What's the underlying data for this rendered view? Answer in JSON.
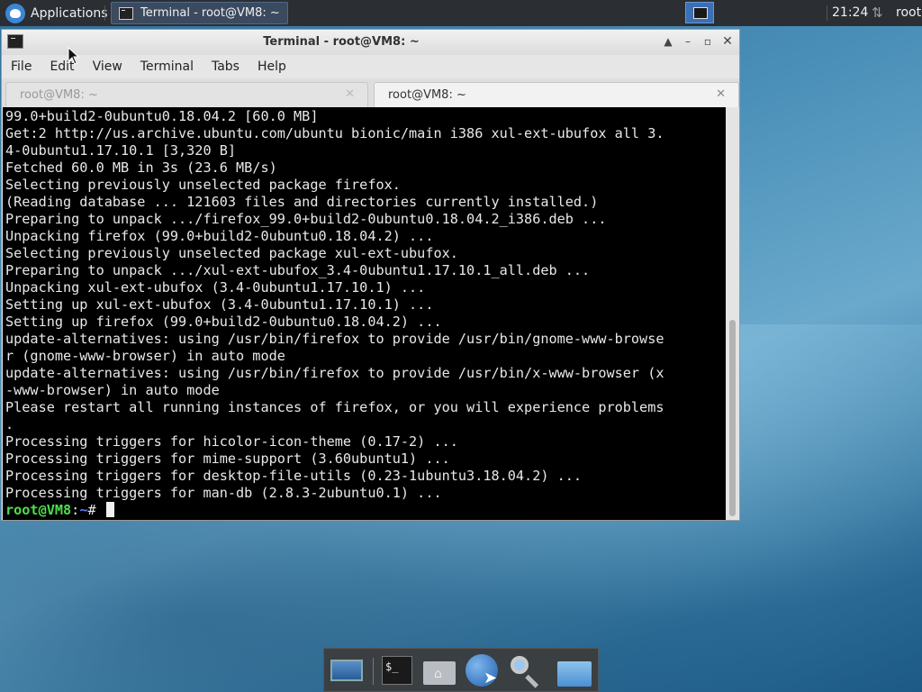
{
  "top_panel": {
    "applications_label": "Applications",
    "task_button_label": "Terminal - root@VM8: ~",
    "clock": "21:24",
    "user": "root"
  },
  "window": {
    "title": "Terminal - root@VM8: ~",
    "menu": [
      "File",
      "Edit",
      "View",
      "Terminal",
      "Tabs",
      "Help"
    ],
    "tabs": [
      {
        "label": "root@VM8: ~",
        "active": false
      },
      {
        "label": "root@VM8: ~",
        "active": true
      }
    ],
    "terminal_lines": [
      "99.0+build2-0ubuntu0.18.04.2 [60.0 MB]",
      "Get:2 http://us.archive.ubuntu.com/ubuntu bionic/main i386 xul-ext-ubufox all 3.",
      "4-0ubuntu1.17.10.1 [3,320 B]",
      "Fetched 60.0 MB in 3s (23.6 MB/s)",
      "Selecting previously unselected package firefox.",
      "(Reading database ... 121603 files and directories currently installed.)",
      "Preparing to unpack .../firefox_99.0+build2-0ubuntu0.18.04.2_i386.deb ...",
      "Unpacking firefox (99.0+build2-0ubuntu0.18.04.2) ...",
      "Selecting previously unselected package xul-ext-ubufox.",
      "Preparing to unpack .../xul-ext-ubufox_3.4-0ubuntu1.17.10.1_all.deb ...",
      "Unpacking xul-ext-ubufox (3.4-0ubuntu1.17.10.1) ...",
      "Setting up xul-ext-ubufox (3.4-0ubuntu1.17.10.1) ...",
      "Setting up firefox (99.0+build2-0ubuntu0.18.04.2) ...",
      "update-alternatives: using /usr/bin/firefox to provide /usr/bin/gnome-www-browse",
      "r (gnome-www-browser) in auto mode",
      "update-alternatives: using /usr/bin/firefox to provide /usr/bin/x-www-browser (x",
      "-www-browser) in auto mode",
      "Please restart all running instances of firefox, or you will experience problems",
      ".",
      "Processing triggers for hicolor-icon-theme (0.17-2) ...",
      "Processing triggers for mime-support (3.60ubuntu1) ...",
      "Processing triggers for desktop-file-utils (0.23-1ubuntu3.18.04.2) ...",
      "Processing triggers for man-db (2.8.3-2ubuntu0.1) ..."
    ],
    "prompt": {
      "user_host": "root@VM8",
      "colon": ":",
      "path": "~",
      "symbol": "# "
    }
  },
  "dock": {
    "items": [
      "desktop-icon",
      "terminal-icon",
      "home-folder-icon",
      "web-browser-icon",
      "search-icon",
      "files-icon"
    ],
    "terminal_glyph": "$_"
  },
  "colors": {
    "terminal_bg": "#000000",
    "prompt_user": "#4ce04c",
    "prompt_path": "#5a7cf0",
    "panel_bg": "#2b2e33"
  }
}
